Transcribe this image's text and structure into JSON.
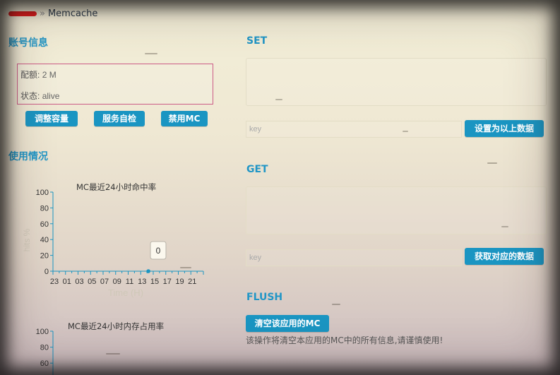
{
  "breadcrumb": {
    "separator": "»",
    "current": "Memcache"
  },
  "account": {
    "title": "账号信息",
    "quota_label": "配额",
    "quota_value": "2 M",
    "status_label": "状态",
    "status_value": "alive",
    "buttons": {
      "resize": "调整容量",
      "selfcheck": "服务自检",
      "disable": "禁用MC"
    }
  },
  "usage": {
    "title": "使用情况"
  },
  "charts": {
    "hit": {
      "title": "MC最近24小时命中率",
      "xlabel": "Time (H)",
      "ylabel": "hits %",
      "tooltip": "0"
    },
    "mem": {
      "title": "MC最近24小时内存占用率"
    }
  },
  "set": {
    "title": "SET",
    "key_placeholder": "key",
    "button": "设置为以上数据"
  },
  "get": {
    "title": "GET",
    "key_placeholder": "key",
    "button": "获取对应的数据"
  },
  "flush": {
    "title": "FLUSH",
    "button": "清空该应用的MC",
    "note": "该操作将清空本应用的MC中的所有信息,请谨慎使用!"
  },
  "colors": {
    "accent": "#1a95c2",
    "box_border": "#cc5b86",
    "redaction": "#e01b1b"
  },
  "chart_data": [
    {
      "type": "line",
      "title": "MC最近24小时命中率",
      "xlabel": "Time (H)",
      "ylabel": "hits %",
      "ylim": [
        0,
        100
      ],
      "y_ticks": [
        "0",
        "20",
        "40",
        "60",
        "80",
        "100"
      ],
      "x_ticks": [
        "23",
        "01",
        "03",
        "05",
        "07",
        "09",
        "11",
        "13",
        "15",
        "17",
        "19",
        "21"
      ],
      "series": [
        {
          "x": [
            "14"
          ],
          "values": [
            0
          ]
        }
      ],
      "annotations": [
        "0"
      ]
    },
    {
      "type": "line",
      "title": "MC最近24小时内存占用率",
      "ylim": [
        0,
        100
      ],
      "y_ticks_visible": [
        "60",
        "80",
        "100"
      ]
    }
  ]
}
